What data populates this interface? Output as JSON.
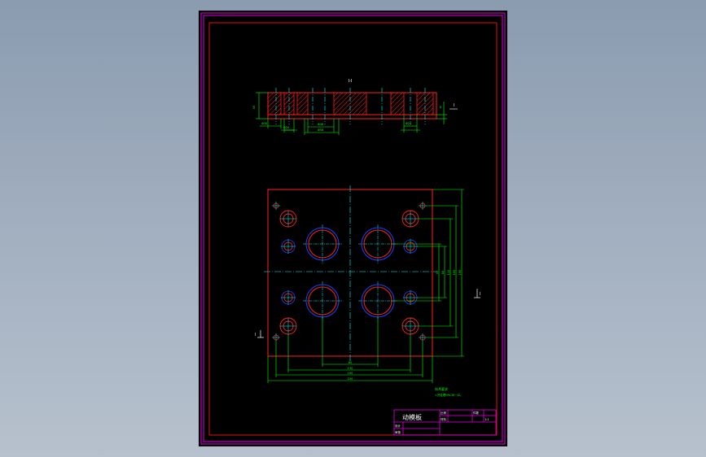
{
  "drawing": {
    "section_label": "I-I",
    "section_marker": "I",
    "plan_markers": {
      "left": "I",
      "right": "I"
    },
    "notes": {
      "line1": "技术要求",
      "line2": "1.热处理HRC38~42。"
    },
    "dims_section": {
      "left_height": "40",
      "d_a": "Φ30",
      "d_b": "Φ20",
      "d_c": "Φ48",
      "d_d": "Φ56",
      "d_e": "Φ20",
      "right_depth": "8"
    },
    "dims_plan": {
      "w1": "80",
      "w2": "130",
      "w3": "190",
      "w4": "230",
      "h1": "40",
      "h2": "80",
      "h3": "110",
      "h4": "160",
      "h5": "190"
    }
  },
  "title_block": {
    "part_name": "动模板",
    "cell_a": "设计",
    "cell_b": "审核",
    "cell_c": "比例",
    "cell_d": "材料",
    "cell_e": "件数",
    "cell_f": "1:1"
  },
  "colors": {
    "frame_outer": "#e000e0",
    "frame_inner": "#e01010",
    "dimension": "#00ff00",
    "center_line": "#00ffff",
    "outline": "#ff2020",
    "text": "#ffffff",
    "hole_outer": "#2040ff",
    "hatch": "#ff2020"
  }
}
